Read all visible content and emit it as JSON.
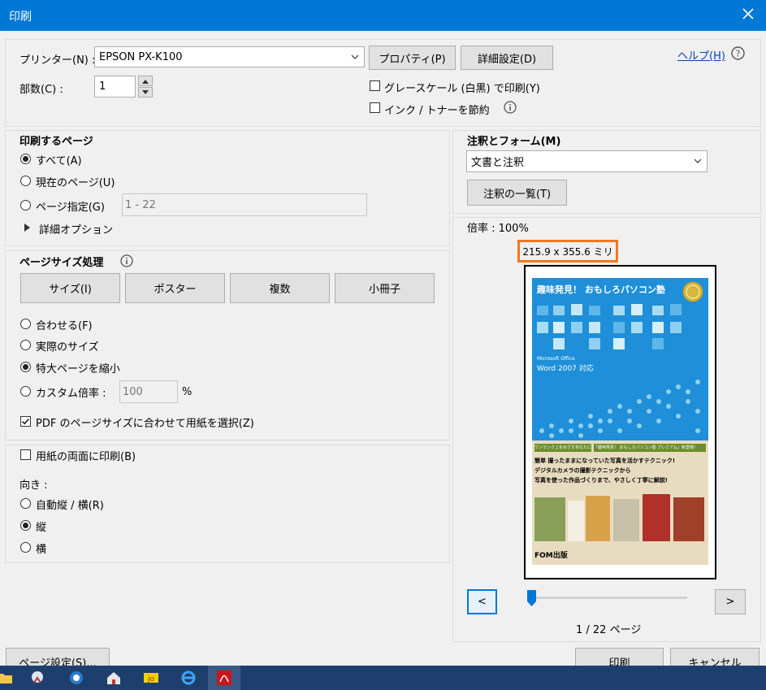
{
  "window": {
    "title": "印刷"
  },
  "printer": {
    "label": "プリンター(N) :",
    "selected": "EPSON PX-K100",
    "properties_button": "プロパティ(P)",
    "advanced_button": "詳細設定(D)",
    "help_link": "ヘルプ(H)",
    "copies_label": "部数(C) :",
    "copies_value": "1",
    "grayscale_label": "グレースケール (白黒) で印刷(Y)",
    "save_ink_label": "インク / トナーを節約"
  },
  "pages_to_print": {
    "heading": "印刷するページ",
    "all": "すべて(A)",
    "current": "現在のページ(U)",
    "pages": "ページ指定(G)",
    "pages_value": "1 - 22",
    "more_options": "詳細オプション"
  },
  "page_sizing": {
    "heading": "ページサイズ処理",
    "tabs": [
      "サイズ(I)",
      "ポスター",
      "複数",
      "小冊子"
    ],
    "fit": "合わせる(F)",
    "actual": "実際のサイズ",
    "shrink": "特大ページを縮小",
    "custom": "カスタム倍率 :",
    "custom_value": "100",
    "percent": "%",
    "choose_source": "PDF のページサイズに合わせて用紙を選択(Z)"
  },
  "duplex": {
    "label": "用紙の両面に印刷(B)",
    "orientation_label": "向き :",
    "auto": "自動縦 / 横(R)",
    "portrait": "縦",
    "landscape": "横"
  },
  "comments_forms": {
    "heading": "注釈とフォーム(M)",
    "selected": "文書と注釈",
    "summarize_button": "注釈の一覧(T)"
  },
  "preview": {
    "scale": "倍率 : 100%",
    "dimensions": "215.9 x 355.6 ミリ",
    "page_indicator": "1 / 22 ページ",
    "prev": "<",
    "next": ">",
    "page_fraction": 0.0,
    "doc": {
      "title_line": "趣味発見！ おもしろパソコン塾",
      "subtitle": "Microsoft Office",
      "product": "Word 2007 対応",
      "band1": "ワンランク上をめざすあなたに",
      "band2": "「趣味発見！ おもしろパソコン塾 プレミアム」新登場！",
      "body1": "簡単 撮ったままになっていた写真を活かすテクニック!",
      "body2": "デジタルカメラの撮影テクニックから",
      "body3": "写真を使った作品づくりまで、やさしく丁寧に解説!",
      "publisher": "FOM出版"
    }
  },
  "footer": {
    "page_setup": "ページ設定(S)...",
    "print": "印刷",
    "cancel": "キャンセル"
  },
  "colors": {
    "titlebar": "#0078d7",
    "highlight_border": "#f07820",
    "doc_blue": "#1e8fd8",
    "taskbar": "#1e3f6e"
  }
}
